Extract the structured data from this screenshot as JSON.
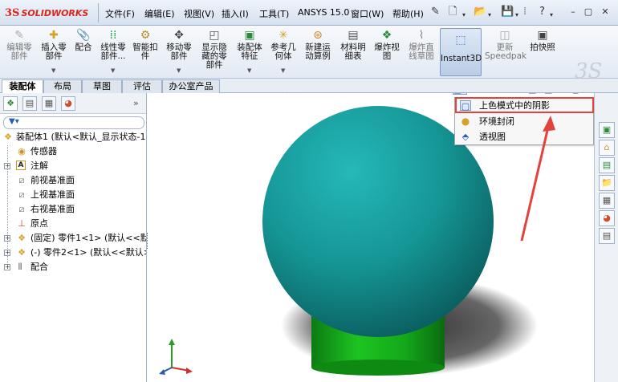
{
  "app": {
    "logo_mark": "3S",
    "logo_text": "SOLIDWORKS"
  },
  "menu": {
    "items": [
      "文件(F)",
      "编辑(E)",
      "视图(V)",
      "插入(I)",
      "工具(T)",
      "ANSYS 15.0",
      "窗口(W)",
      "帮助(H)"
    ]
  },
  "commands": [
    {
      "icon": "edit-part-icon",
      "label": "编辑零\n部件",
      "enabled": false
    },
    {
      "icon": "insert-component-icon",
      "label": "插入零\n部件",
      "enabled": true,
      "dropdown": true
    },
    {
      "icon": "mate-icon",
      "label": "配合",
      "enabled": true
    },
    {
      "icon": "linear-pattern-icon",
      "label": "线性零\n部件...",
      "enabled": true,
      "dropdown": true
    },
    {
      "icon": "smart-fastener-icon",
      "label": "智能扣\n件",
      "enabled": true
    },
    {
      "icon": "move-component-icon",
      "label": "移动零\n部件",
      "enabled": true,
      "dropdown": true
    },
    {
      "icon": "show-hidden-icon",
      "label": "显示隐\n藏的零\n部件",
      "enabled": true
    },
    {
      "icon": "assembly-feature-icon",
      "label": "装配体\n特征",
      "enabled": true,
      "dropdown": true
    },
    {
      "icon": "reference-geometry-icon",
      "label": "参考几\n何体",
      "enabled": true,
      "dropdown": true
    },
    {
      "icon": "motion-study-icon",
      "label": "新建运\n动算例",
      "enabled": true
    },
    {
      "icon": "bom-icon",
      "label": "材料明\n细表",
      "enabled": true
    },
    {
      "icon": "exploded-view-icon",
      "label": "爆炸视\n图",
      "enabled": true
    },
    {
      "icon": "explode-line-icon",
      "label": "爆炸直\n线草图",
      "enabled": true
    },
    {
      "icon": "instant3d-icon",
      "label": "Instant3D",
      "enabled": true,
      "active": true
    },
    {
      "icon": "speedpak-icon",
      "label": "更新\nSpeedpak",
      "enabled": false
    },
    {
      "icon": "snapshot-icon",
      "label": "拍快照",
      "enabled": true
    }
  ],
  "tabs": [
    "装配体",
    "布局",
    "草图",
    "评估",
    "办公室产品"
  ],
  "feature_tree": [
    {
      "label": "装配体1  (默认<默认_显示状态-1",
      "icon": "assembly-icon",
      "level": 0
    },
    {
      "label": "传感器",
      "icon": "sensor-icon",
      "level": 1
    },
    {
      "label": "注解",
      "icon": "annotation-icon",
      "level": 1,
      "expandable": true
    },
    {
      "label": "前视基准面",
      "icon": "plane-icon",
      "level": 1
    },
    {
      "label": "上视基准面",
      "icon": "plane-icon",
      "level": 1
    },
    {
      "label": "右视基准面",
      "icon": "plane-icon",
      "level": 1
    },
    {
      "label": "原点",
      "icon": "origin-icon",
      "level": 1
    },
    {
      "label": "(固定) 零件1<1> (默认<<默",
      "icon": "part-icon",
      "level": 1,
      "expandable": true
    },
    {
      "label": "(-) 零件2<1> (默认<<默认>",
      "icon": "part-icon",
      "level": 1,
      "expandable": true
    },
    {
      "label": "配合",
      "icon": "mates-folder-icon",
      "level": 0,
      "expandable": true
    }
  ],
  "display_style_menu": {
    "items": [
      {
        "label": "上色模式中的阴影",
        "icon": "shadows-icon"
      },
      {
        "label": "环境封闭",
        "icon": "ambient-occlusion-icon"
      },
      {
        "label": "透视图",
        "icon": "perspective-icon"
      }
    ],
    "highlighted_index": 0
  },
  "colors": {
    "sphere": "#1b9a9a",
    "cylinder": "#18c41a",
    "annotation": "#e2433a",
    "logo": "#d9261c"
  }
}
